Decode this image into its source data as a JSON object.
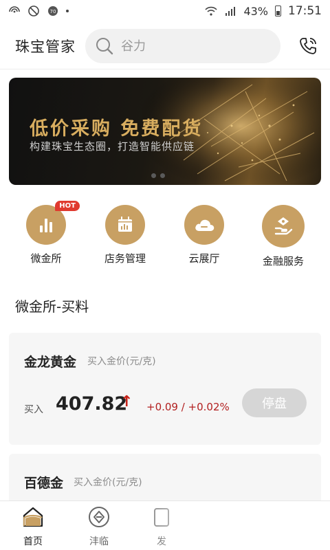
{
  "status_bar": {
    "battery_percent": "43%",
    "time": "17:51"
  },
  "header": {
    "app_title": "珠宝管家",
    "search_placeholder": "谷力"
  },
  "banner": {
    "title": "低价采购 免费配货",
    "subtitle": "构建珠宝生态圈，打造智能供应链"
  },
  "quick_menu": {
    "items": [
      {
        "label": "微金所",
        "icon": "chart-bars-icon",
        "badge": "HOT"
      },
      {
        "label": "店务管理",
        "icon": "calendar-chart-icon"
      },
      {
        "label": "云展厅",
        "icon": "cloud-icon"
      },
      {
        "label": "金融服务",
        "icon": "finance-hand-icon"
      }
    ]
  },
  "section": {
    "title": "微金所-买料"
  },
  "cards": [
    {
      "name": "金龙黄金",
      "hint": "买入金价(元/克)",
      "buy_label": "买入",
      "price": "407.82",
      "trend_arrow": "↑",
      "change": "+0.09 / +0.02%",
      "action_label": "停盘"
    },
    {
      "name": "百德金",
      "hint": "买入金价(元/克)"
    }
  ],
  "bottom_nav": {
    "items": [
      {
        "label": "首页",
        "icon": "home-icon",
        "active": true
      },
      {
        "label": "沣临",
        "icon": "diamond-circle-icon",
        "active": false
      },
      {
        "label": "发",
        "icon": "card-icon",
        "active": false
      }
    ]
  },
  "colors": {
    "accent_gold": "#c8a063",
    "price_up": "#c8231a",
    "badge_red": "#e03a2f"
  }
}
